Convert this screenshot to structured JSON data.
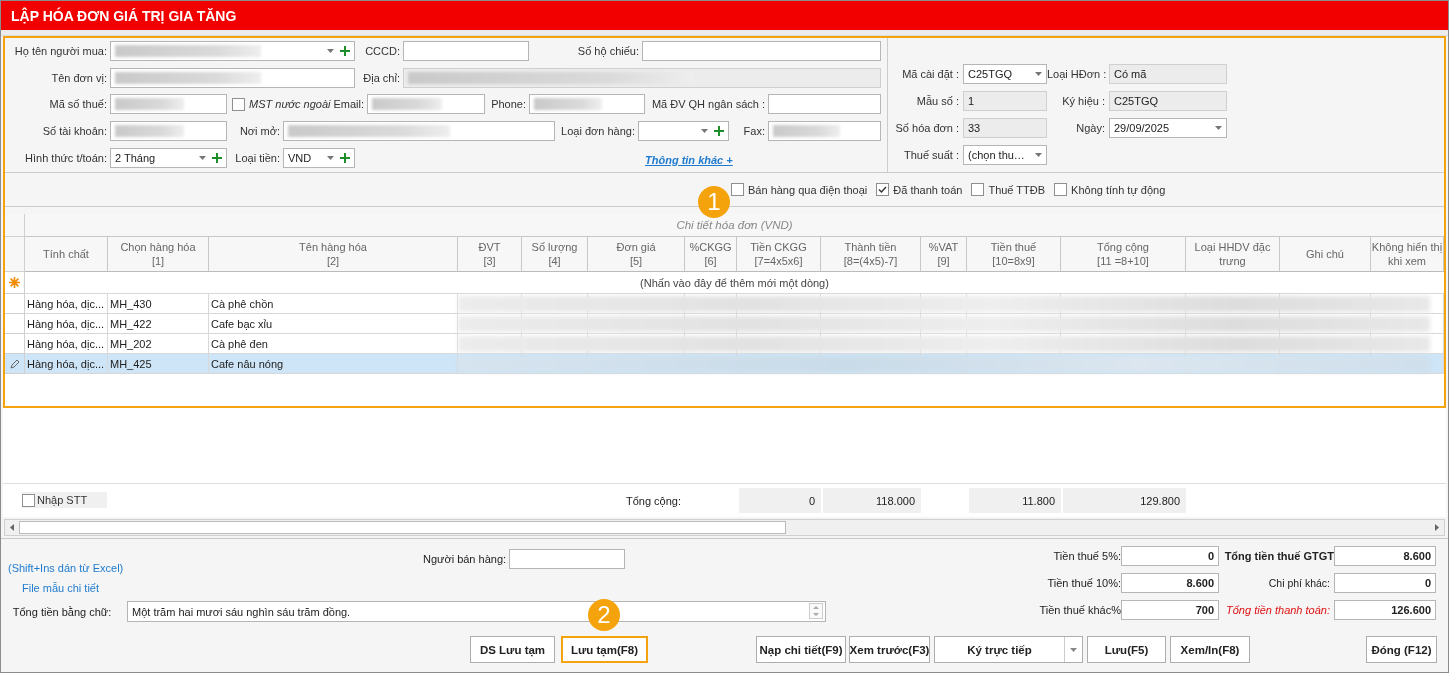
{
  "title": "LẬP HÓA ĐƠN GIÁ TRỊ GIA TĂNG",
  "buyer_rows": [
    [
      {
        "kind": "combo_add",
        "label": "Họ tên người mua:",
        "redacted": true
      },
      {
        "kind": "text",
        "label": "CCCD:"
      },
      {
        "kind": "text",
        "label": "Số hộ chiếu:"
      }
    ],
    [
      {
        "kind": "text",
        "label": "Tên đơn vị:",
        "redacted": true
      },
      {
        "kind": "text",
        "label": "Địa chỉ:",
        "redacted": true,
        "disabled": true
      }
    ],
    [
      {
        "kind": "text",
        "label": "Mã số thuế:",
        "redacted": true
      },
      {
        "kind": "checkbox",
        "label": "MST nước ngoài",
        "checked": false
      },
      {
        "kind": "text",
        "label": "Email:",
        "redacted": true
      },
      {
        "kind": "text",
        "label": "Phone:",
        "redacted": true
      },
      {
        "kind": "text",
        "label": "Mã ĐV QH ngân sách :"
      }
    ],
    [
      {
        "kind": "text",
        "label": "Số tài khoản:",
        "redacted": true
      },
      {
        "kind": "text",
        "label": "Nơi mở:",
        "redacted": true
      },
      {
        "kind": "combo_add",
        "label": "Loại đơn hàng:"
      },
      {
        "kind": "text",
        "label": "Fax:",
        "redacted": true
      }
    ],
    [
      {
        "kind": "combo_add",
        "label": "Hình thức t/toán:",
        "value": "2 Tháng"
      },
      {
        "kind": "combo_add",
        "label": "Loại tiền:",
        "value": "VND"
      },
      {
        "kind": "link",
        "label": "Thông tin khác +"
      }
    ]
  ],
  "invoice_rows": [
    [
      {
        "kind": "combo",
        "label": "Mã cài đặt :",
        "value": "C25TGQ"
      },
      {
        "kind": "text",
        "label": "Loại HĐơn :",
        "value": "Có mã",
        "disabled": true
      }
    ],
    [
      {
        "kind": "text",
        "label": "Mẫu số :",
        "value": "1",
        "disabled": true
      },
      {
        "kind": "text",
        "label": "Ký hiệu :",
        "value": "C25TGQ",
        "disabled": true
      }
    ],
    [
      {
        "kind": "text",
        "label": "Số hóa đơn :",
        "value": "33",
        "disabled": true
      },
      {
        "kind": "combo",
        "label": "Ngày:",
        "value": "29/09/2025"
      }
    ],
    [
      {
        "kind": "combo",
        "label": "Thuế suất :",
        "value": "(chọn thu…"
      }
    ]
  ],
  "options": [
    {
      "label": "Bán hàng qua điện thoại",
      "checked": false
    },
    {
      "label": "Đã thanh toán",
      "checked": true
    },
    {
      "label": "Thuế TTĐB",
      "checked": false
    },
    {
      "label": "Không tính tự động",
      "checked": false
    }
  ],
  "grid": {
    "band": "Chi tiết hóa đơn (VND)",
    "columns": [
      {
        "title": "Tính chất"
      },
      {
        "title": "Chọn hàng hóa",
        "formula": "[1]"
      },
      {
        "title": "Tên hàng hóa",
        "formula": "[2]"
      },
      {
        "title": "ĐVT",
        "formula": "[3]"
      },
      {
        "title": "Số lượng",
        "formula": "[4]"
      },
      {
        "title": "Đơn giá",
        "formula": "[5]"
      },
      {
        "title": "%CKGG",
        "formula": "[6]"
      },
      {
        "title": "Tiền CKGG",
        "formula": "[7=4x5x6]",
        "total": "0"
      },
      {
        "title": "Thành tiền",
        "formula": "[8=(4x5)-7]",
        "total": "118.000"
      },
      {
        "title": "%VAT",
        "formula": "[9]"
      },
      {
        "title": "Tiền thuế",
        "formula": "[10=8x9]",
        "total": "11.800"
      },
      {
        "title": "Tổng cộng",
        "formula": "[11 =8+10]",
        "total": "129.800"
      },
      {
        "title": "Loại HHDV đặc trưng"
      },
      {
        "title": "Ghi chú"
      },
      {
        "title": "Không hiển thị khi xem"
      }
    ],
    "new_row_hint": "(Nhấn vào đây để thêm mới một dòng)",
    "rows": [
      {
        "cells": [
          "Hàng hóa, dịc...",
          "MH_430",
          "Cà phê chồn"
        ],
        "selected": false
      },
      {
        "cells": [
          "Hàng hóa, dịc...",
          "MH_422",
          "Cafe bạc xỉu"
        ],
        "selected": false
      },
      {
        "cells": [
          "Hàng hóa, dịc...",
          "MH_202",
          "Cà phê đen"
        ],
        "selected": false
      },
      {
        "cells": [
          "Hàng hóa, dịc...",
          "MH_425",
          "Cafe nâu nóng"
        ],
        "selected": true
      }
    ],
    "numbering": {
      "label": "Nhập STT",
      "checked": false
    },
    "totals_label": "Tổng cộng:"
  },
  "seller": {
    "label": "Người bán hàng:"
  },
  "links": [
    "(Shift+Ins dán từ Excel)",
    "File mẫu chi tiết"
  ],
  "amount_words": {
    "label": "Tổng tiền bằng chữ:",
    "value": "Một trăm hai mươi sáu nghìn sáu trăm đồng."
  },
  "tax_summary": [
    {
      "label": "Tiền thuế 5%:",
      "value": "0",
      "kind": "normal"
    },
    {
      "label": "Tổng tiền thuế GTGT",
      "value": "8.600",
      "kind": "bold"
    },
    {
      "label": "Tiền thuế 10%:",
      "value": "8.600",
      "kind": "normal"
    },
    {
      "label": "Chi phí khác:",
      "value": "0",
      "kind": "small"
    },
    {
      "label": "Tiền thuế khác%",
      "value": "700",
      "kind": "normal"
    },
    {
      "label": "Tổng tiền thanh toán:",
      "value": "126.600",
      "kind": "emphasis"
    }
  ],
  "buttons": [
    {
      "label": "DS Lưu tạm",
      "kind": "button",
      "highlighted": false
    },
    {
      "label": "Lưu tạm(F8)",
      "kind": "button",
      "highlighted": true
    },
    {
      "label": "Nạp chi tiết(F9)",
      "kind": "button",
      "highlighted": false
    },
    {
      "label": "Xem trước(F3)",
      "kind": "button",
      "highlighted": false
    },
    {
      "label": "Ký trực tiếp",
      "kind": "split",
      "highlighted": false
    },
    {
      "label": "Lưu(F5)",
      "kind": "button",
      "highlighted": false
    },
    {
      "label": "Xem/In(F8)",
      "kind": "button",
      "highlighted": false
    },
    {
      "label": "Đóng (F12)",
      "kind": "button",
      "highlighted": false
    }
  ],
  "callouts": [
    {
      "label": "1"
    },
    {
      "label": "2"
    }
  ]
}
